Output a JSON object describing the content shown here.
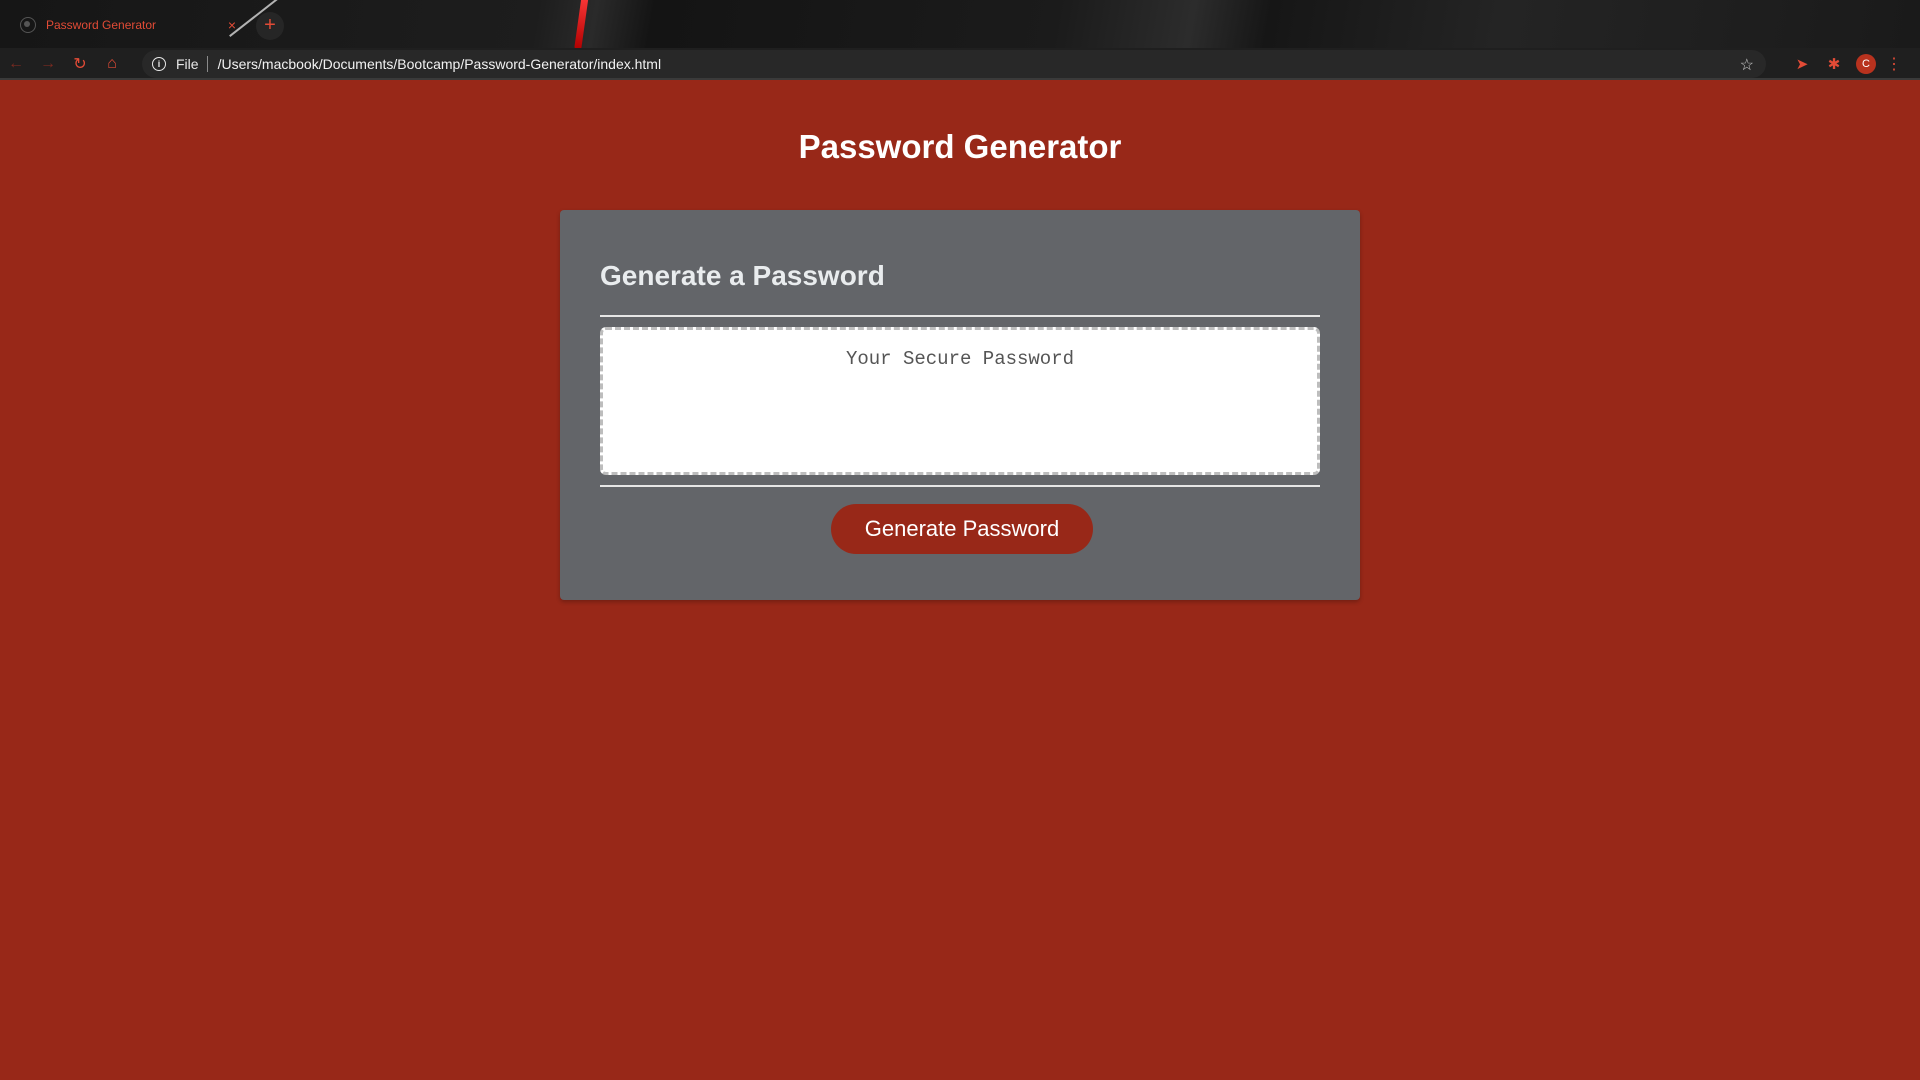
{
  "browser": {
    "tab_title": "Password Generator",
    "tab_close": "×",
    "new_tab": "+",
    "omnibox_scheme": "File",
    "omnibox_url": "/Users/macbook/Documents/Bootcamp/Password-Generator/index.html",
    "profile_initial": "C",
    "accent_color": "#e24b36"
  },
  "page": {
    "title": "Password Generator",
    "background_color": "#982818"
  },
  "card": {
    "header": "Generate a Password",
    "password_placeholder": "Your Secure Password",
    "password_value": "",
    "button_label": "Generate Password",
    "card_color": "#636569"
  }
}
